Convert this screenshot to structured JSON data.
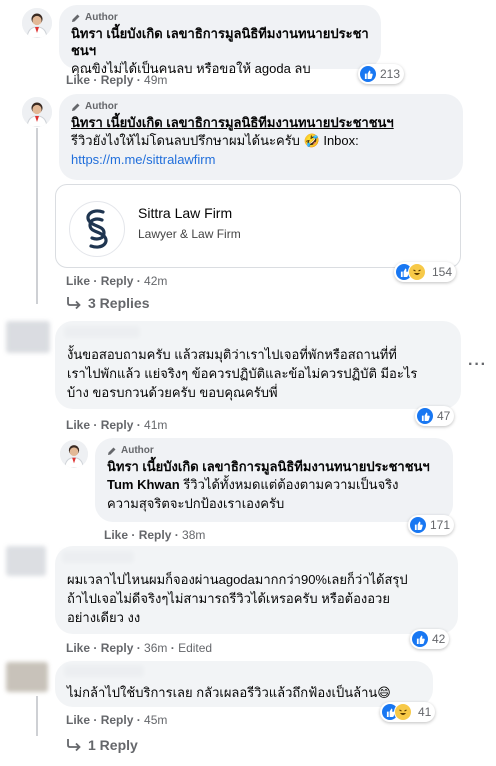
{
  "comments": [
    {
      "author_badge": "Author",
      "name": "นิทรา เนี้ยบังเกิด เลขาธิการมูลนิธิทีมงานทนายประชาชนฯ",
      "text": "คุณขิงไม่ได้เป็นคนลบ หรือขอให้ agoda ลบ",
      "like": "Like",
      "reply": "Reply",
      "time": "49m",
      "reaction_count": "213"
    },
    {
      "author_badge": "Author",
      "name": "นิทรา เนี้ยบังเกิด เลขาธิการมูลนิธิทีมงานทนายประชาชนฯ",
      "text": "รีวิวยังไงให้ไม่โดนลบปรึกษาผมได้นะครับ 🤣 Inbox:",
      "link": "https://m.me/sittralawfirm",
      "card_title": "Sittra Law Firm",
      "card_subtitle": "Lawyer & Law Firm",
      "like": "Like",
      "reply": "Reply",
      "time": "42m",
      "reaction_count": "154",
      "replies_label": "3 Replies"
    },
    {
      "text": "งั้นขอสอบถามครับ แล้วสมมุติว่าเราไปเจอที่พักหรือสถานที่ที่\nเราไปพักแล้ว แย่จริงๆ ข้อควรปฏิบัติและข้อไม่ควรปฏิบัติ มีอะไร\nบ้าง ขอรบกวนด้วยครับ ขอบคุณครับพี่",
      "like": "Like",
      "reply": "Reply",
      "time": "41m",
      "reaction_count": "47"
    },
    {
      "author_badge": "Author",
      "name": "นิทรา เนี้ยบังเกิด เลขาธิการมูลนิธิทีมงานทนายประชาชนฯ",
      "tag": "Tum Khwan",
      "text": "รีวิวได้ทั้งหมดแต่ต้องตามความเป็นจริง\nความสุจริตจะปกป้องเราเองครับ",
      "like": "Like",
      "reply": "Reply",
      "time": "38m",
      "reaction_count": "171"
    },
    {
      "text": "ผมเวลาไปไหนผมก็จองผ่านagodaมากกว่า90%เลยก็ว่าได้สรุป\nถ้าไปเจอไม่ดีจริงๆไม่สามารถรีวิวได้เหรอครับ หรือต้องอวย\nอย่างเดียว งง",
      "like": "Like",
      "reply": "Reply",
      "time": "36m",
      "edited": "Edited",
      "reaction_count": "42"
    },
    {
      "text": "ไม่กล้าไปใช้บริการเลย กลัวเผลอรีวิวแล้วถึกฟ้องเป็นล้าน😄",
      "like": "Like",
      "reply": "Reply",
      "time": "45m",
      "reaction_count": "41",
      "replies_label": "1 Reply"
    }
  ],
  "icons": [
    "pencil-icon",
    "like-icon",
    "haha-icon",
    "reply-arrow-icon",
    "more-dots-icon",
    "law-firm-logo"
  ],
  "colors": {
    "like_blue": "#1877f2",
    "link_blue": "#216fdb",
    "meta_gray": "#65676b",
    "bubble_bg": "#f0f2f5"
  }
}
